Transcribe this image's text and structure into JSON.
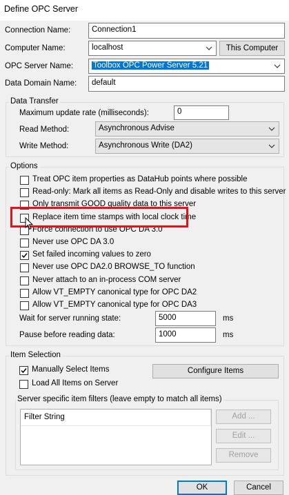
{
  "window": {
    "title": "Define OPC Server"
  },
  "connection": {
    "connection_name_label": "Connection Name:",
    "connection_name_value": "Connection1",
    "computer_name_label": "Computer Name:",
    "computer_name_value": "localhost",
    "this_computer_button": "This Computer",
    "opc_server_name_label": "OPC Server Name:",
    "opc_server_name_value": "Toolbox OPC Power Server 5.21",
    "data_domain_label": "Data Domain Name:",
    "data_domain_value": "default"
  },
  "data_transfer": {
    "group_label": "Data Transfer",
    "max_update_label": "Maximum update rate (milliseconds):",
    "max_update_value": "0",
    "read_method_label": "Read Method:",
    "read_method_value": "Asynchronous Advise",
    "write_method_label": "Write Method:",
    "write_method_value": "Asynchronous Write (DA2)"
  },
  "options": {
    "group_label": "Options",
    "items": [
      {
        "label": "Treat OPC item properties as DataHub points where possible",
        "checked": false
      },
      {
        "label": "Read-only: Mark all items as Read-Only and disable writes to this server",
        "checked": false
      },
      {
        "label": "Only transmit GOOD quality data to this server",
        "checked": false
      },
      {
        "label": "Replace item time stamps with local clock time",
        "checked": false
      },
      {
        "label": "Force connection to use OPC DA 3.0",
        "checked": false
      },
      {
        "label": "Never use OPC DA 3.0",
        "checked": false
      },
      {
        "label": "Set failed incoming values to zero",
        "checked": true
      },
      {
        "label": "Never use OPC DA2.0 BROWSE_TO function",
        "checked": false
      },
      {
        "label": "Never attach to an in-process COM server",
        "checked": false
      },
      {
        "label": "Allow VT_EMPTY canonical type for OPC DA2",
        "checked": false
      },
      {
        "label": "Allow VT_EMPTY canonical type for OPC DA3",
        "checked": false
      }
    ],
    "wait_label": "Wait for server running state:",
    "wait_value": "5000",
    "wait_unit": "ms",
    "pause_label": "Pause before reading data:",
    "pause_value": "1000",
    "pause_unit": "ms"
  },
  "item_selection": {
    "group_label": "Item Selection",
    "manually_select_label": "Manually Select Items",
    "manually_select_checked": true,
    "load_all_label": "Load All Items on Server",
    "load_all_checked": false,
    "configure_button": "Configure Items",
    "filters_group_label": "Server specific item filters (leave empty to match all items)",
    "filter_column_header": "Filter String",
    "add_button": "Add ...",
    "edit_button": "Edit ...",
    "remove_button": "Remove"
  },
  "footer": {
    "ok_button": "OK",
    "cancel_button": "Cancel"
  },
  "colors": {
    "highlight_border": "#e0141a",
    "selection": "#0078d7",
    "default_button_border": "#0078d7"
  }
}
